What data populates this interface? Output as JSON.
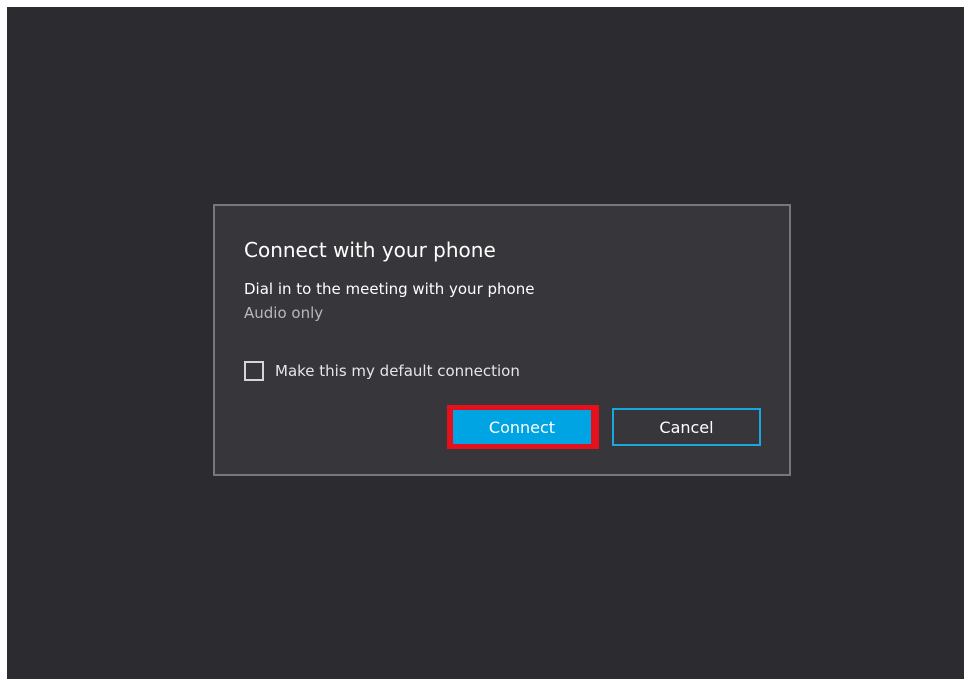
{
  "dialog": {
    "title": "Connect with your phone",
    "subtitle": "Dial in to the meeting with your phone",
    "subnote": "Audio only",
    "checkbox": {
      "label": "Make this my default connection",
      "checked": false
    },
    "buttons": {
      "connect_label": "Connect",
      "cancel_label": "Cancel"
    }
  },
  "colors": {
    "background": "#2c2b30",
    "dialog_bg": "#36363b",
    "dialog_border": "#76767c",
    "accent": "#00a4e3",
    "highlight": "#e5101b"
  }
}
